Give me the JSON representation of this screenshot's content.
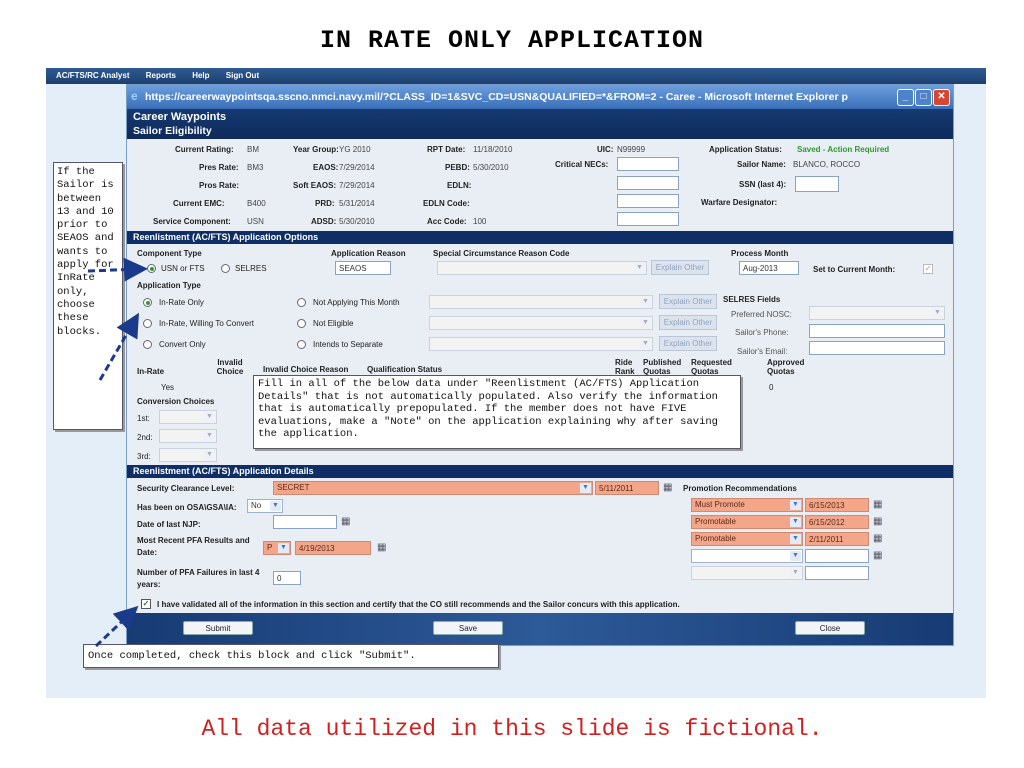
{
  "slide": {
    "title": "IN RATE ONLY APPLICATION",
    "footer": "All data utilized in this slide is fictional."
  },
  "menubar": [
    "AC/FTS/RC Analyst",
    "Reports",
    "Help",
    "Sign Out"
  ],
  "browser": {
    "url_title": "https://careerwaypointsqa.sscno.nmci.navy.mil/?CLASS_ID=1&SVC_CD=USN&QUALIFIED=*&FROM=2 - Caree - Microsoft Internet Explorer p"
  },
  "app": {
    "name": "Career Waypoints",
    "subtitle": "Sailor Eligibility"
  },
  "eligibility": {
    "current_rating_label": "Current Rating:",
    "current_rating": "BM",
    "pres_rate_label": "Pres Rate:",
    "pres_rate": "BM3",
    "pros_rate_label": "Pros Rate:",
    "pros_rate": "",
    "current_emc_label": "Current EMC:",
    "current_emc": "B400",
    "service_component_label": "Service Component:",
    "service_component": "USN",
    "year_group_label": "Year Group:",
    "year_group": "YG 2010",
    "eaos_label": "EAOS:",
    "eaos": "7/29/2014",
    "soft_eaos_label": "Soft EAOS:",
    "soft_eaos": "7/29/2014",
    "prd_label": "PRD:",
    "prd": "5/31/2014",
    "adsd_label": "ADSD:",
    "adsd": "5/30/2010",
    "rpt_date_label": "RPT Date:",
    "rpt_date": "11/18/2010",
    "pebd_label": "PEBD:",
    "pebd": "5/30/2010",
    "edln_label": "EDLN:",
    "edln": "",
    "edln_code_label": "EDLN Code:",
    "edln_code": "",
    "acc_code_label": "Acc Code:",
    "acc_code": "100",
    "uic_label": "UIC:",
    "uic": "N99999",
    "critical_necs_label": "Critical NECs:",
    "app_status_label": "Application Status:",
    "app_status": "Saved - Action Required",
    "sailor_name_label": "Sailor Name:",
    "sailor_name": "BLANCO, ROCCO",
    "ssn_label": "SSN (last 4):",
    "warfare_label": "Warfare Designator:"
  },
  "options": {
    "section_title": "Reenlistment (AC/FTS) Application Options",
    "component_type_label": "Component Type",
    "component_types": [
      "USN or FTS",
      "SELRES"
    ],
    "application_reason_label": "Application Reason",
    "application_reason": "SEAOS",
    "special_circ_label": "Special Circumstance Reason Code",
    "explain_other": "Explain Other",
    "process_month_label": "Process Month",
    "process_month": "Aug-2013",
    "set_current_label": "Set to Current Month:",
    "application_type_label": "Application Type",
    "app_types_left": [
      "In-Rate Only",
      "In-Rate, Willing To Convert",
      "Convert Only"
    ],
    "app_types_right": [
      "Not Applying This Month",
      "Not Eligible",
      "Intends to Separate"
    ],
    "selres_fields_label": "SELRES Fields",
    "preferred_nosc_label": "Preferred NOSC:",
    "sailors_phone_label": "Sailor's Phone:",
    "sailors_email_label": "Sailor's Email:",
    "col_in_rate": "In-Rate",
    "col_invalid_choice": "Invalid Choice",
    "col_invalid_reason": "Invalid Choice Reason",
    "col_qual_status": "Qualification Status",
    "col_ride_rank": "Ride Rank",
    "col_published": "Published Quotas",
    "col_requested": "Requested Quotas",
    "col_approved": "Approved Quotas",
    "in_rate_value": "Yes",
    "approved_value": "0",
    "conversion_choices_label": "Conversion Choices",
    "choices": [
      "1st:",
      "2nd:",
      "3rd:"
    ]
  },
  "details": {
    "section_title": "Reenlistment (AC/FTS) Application Details",
    "security_label": "Security Clearance Level:",
    "security_value": "SECRET",
    "security_date": "5/11/2011",
    "osa_label": "Has been on OSA\\GSA\\IA:",
    "osa_value": "No",
    "njp_label": "Date of last NJP:",
    "pfa_label": "Most Recent PFA Results and Date:",
    "pfa_value": "P",
    "pfa_date": "4/19/2013",
    "pfa_failures_label": "Number of PFA Failures in last 4 years:",
    "pfa_failures": "0",
    "promo_label": "Promotion Recommendations",
    "promos": [
      {
        "value": "Must Promote",
        "date": "6/15/2013"
      },
      {
        "value": "Promotable",
        "date": "6/15/2012"
      },
      {
        "value": "Promotable",
        "date": "2/11/2011"
      },
      {
        "value": "",
        "date": ""
      },
      {
        "value": "",
        "date": ""
      }
    ],
    "certify_text": "I have validated all of the information in this section and certify that the CO still recommends and the Sailor concurs with this application."
  },
  "buttons": {
    "submit": "Submit",
    "save": "Save",
    "close": "Close"
  },
  "callouts": {
    "left": "If the Sailor is between 13 and 10 prior to SEAOS and wants to apply for InRate only, choose these blocks.",
    "middle": "Fill in all of the below data under \"Reenlistment (AC/FTS) Application Details\" that is not automatically populated.  Also verify the information that is automatically prepopulated.  If the member does not have FIVE evaluations, make a \"Note\" on the application explaining why after saving the application.",
    "bottom": "Once completed, check this block and click \"Submit\"."
  },
  "colors": {
    "header_navy": "#0f2e66",
    "salmon": "#f3a68a",
    "status_green": "#2e9a2e",
    "footer_red": "#d02020"
  }
}
